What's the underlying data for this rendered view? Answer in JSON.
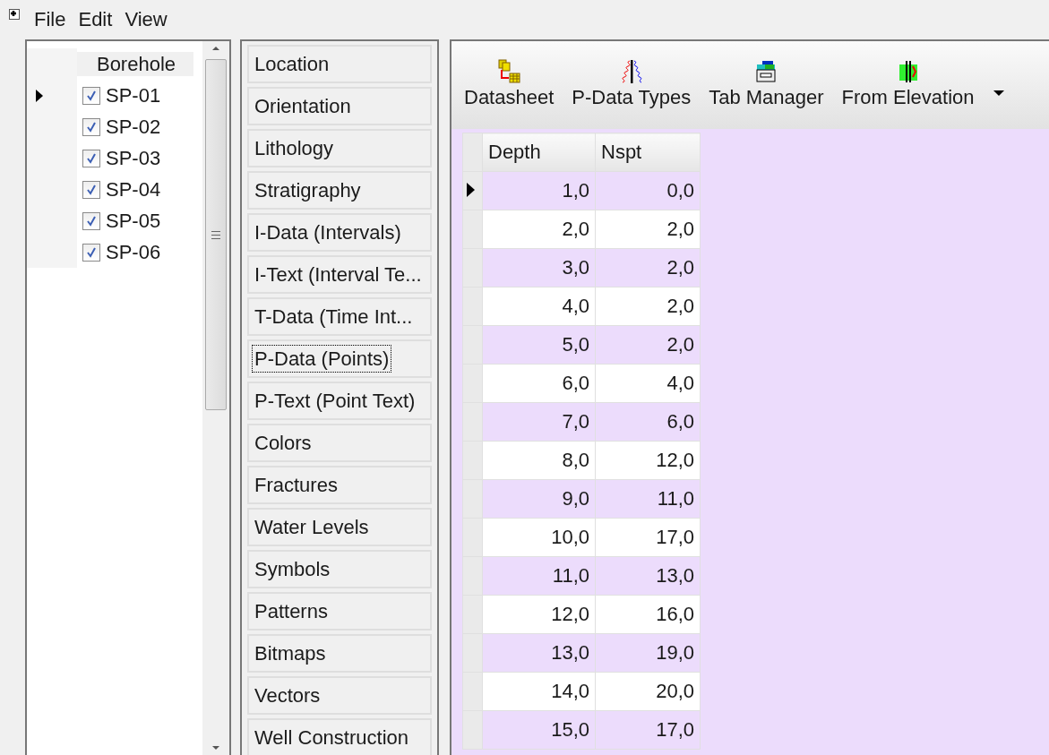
{
  "menu": [
    "File",
    "Edit",
    "View"
  ],
  "boreholes": {
    "header": "Borehole",
    "items": [
      {
        "name": "SP-01",
        "checked": true,
        "current": true
      },
      {
        "name": "SP-02",
        "checked": true,
        "current": false
      },
      {
        "name": "SP-03",
        "checked": true,
        "current": false
      },
      {
        "name": "SP-04",
        "checked": true,
        "current": false
      },
      {
        "name": "SP-05",
        "checked": true,
        "current": false
      },
      {
        "name": "SP-06",
        "checked": true,
        "current": false
      }
    ]
  },
  "categories": [
    {
      "label": "Location",
      "selected": false
    },
    {
      "label": "Orientation",
      "selected": false
    },
    {
      "label": "Lithology",
      "selected": false
    },
    {
      "label": "Stratigraphy",
      "selected": false
    },
    {
      "label": "I-Data (Intervals)",
      "selected": false
    },
    {
      "label": "I-Text (Interval Te...",
      "selected": false
    },
    {
      "label": "T-Data (Time Int...",
      "selected": false
    },
    {
      "label": "P-Data (Points)",
      "selected": true
    },
    {
      "label": "P-Text (Point Text)",
      "selected": false
    },
    {
      "label": "Colors",
      "selected": false
    },
    {
      "label": "Fractures",
      "selected": false
    },
    {
      "label": "Water Levels",
      "selected": false
    },
    {
      "label": "Symbols",
      "selected": false
    },
    {
      "label": "Patterns",
      "selected": false
    },
    {
      "label": "Bitmaps",
      "selected": false
    },
    {
      "label": "Vectors",
      "selected": false
    },
    {
      "label": "Well Construction",
      "selected": false
    }
  ],
  "toolbar": [
    {
      "label": "Datasheet",
      "kind": "datasheet"
    },
    {
      "label": "P-Data Types",
      "kind": "types"
    },
    {
      "label": "Tab Manager",
      "kind": "tabs"
    },
    {
      "label": "From Elevation",
      "kind": "elevation"
    }
  ],
  "grid": {
    "columns": [
      "Depth",
      "Nspt"
    ],
    "rows": [
      {
        "cells": [
          "1,0",
          "0,0"
        ],
        "current": true
      },
      {
        "cells": [
          "2,0",
          "2,0"
        ],
        "current": false
      },
      {
        "cells": [
          "3,0",
          "2,0"
        ],
        "current": false
      },
      {
        "cells": [
          "4,0",
          "2,0"
        ],
        "current": false
      },
      {
        "cells": [
          "5,0",
          "2,0"
        ],
        "current": false
      },
      {
        "cells": [
          "6,0",
          "4,0"
        ],
        "current": false
      },
      {
        "cells": [
          "7,0",
          "6,0"
        ],
        "current": false
      },
      {
        "cells": [
          "8,0",
          "12,0"
        ],
        "current": false
      },
      {
        "cells": [
          "9,0",
          "11,0"
        ],
        "current": false
      },
      {
        "cells": [
          "10,0",
          "17,0"
        ],
        "current": false
      },
      {
        "cells": [
          "11,0",
          "13,0"
        ],
        "current": false
      },
      {
        "cells": [
          "12,0",
          "16,0"
        ],
        "current": false
      },
      {
        "cells": [
          "13,0",
          "19,0"
        ],
        "current": false
      },
      {
        "cells": [
          "14,0",
          "20,0"
        ],
        "current": false
      },
      {
        "cells": [
          "15,0",
          "17,0"
        ],
        "current": false
      }
    ]
  }
}
